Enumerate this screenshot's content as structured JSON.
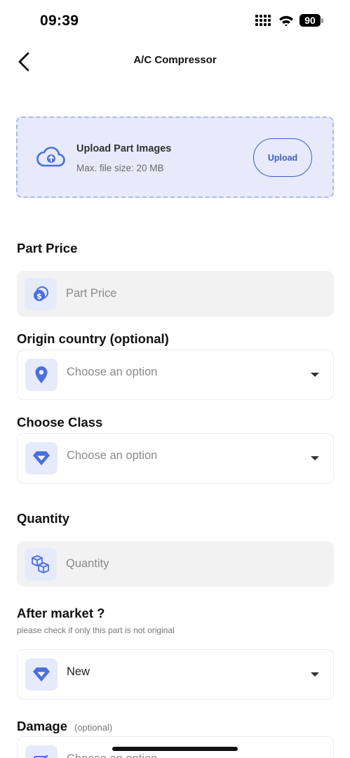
{
  "status_bar": {
    "time": "09:39",
    "battery": "90",
    "icons": [
      "signal-icon",
      "wifi-icon",
      "battery-icon"
    ]
  },
  "nav": {
    "title": "A/C Compressor",
    "back_icon": "chevron-left-icon"
  },
  "upload": {
    "title": "Upload Part Images",
    "subtitle": "Max. file size: 20 MB",
    "button_label": "Upload",
    "icon": "cloud-upload-icon"
  },
  "form": {
    "part_price": {
      "label": "Part Price",
      "placeholder": "Part Price",
      "icon": "dollar-coin-icon"
    },
    "origin_country": {
      "label": "Origin country (optional)",
      "value": "Choose an option",
      "icon": "location-pin-icon"
    },
    "choose_class": {
      "label": "Choose Class",
      "value": "Choose an option",
      "icon": "diamond-icon"
    },
    "quantity": {
      "label": "Quantity",
      "placeholder": "Quantity",
      "icon": "boxes-icon"
    },
    "after_market": {
      "label": "After market ?",
      "hint": "please check if only this part is not original",
      "value": "New",
      "icon": "diamond-icon"
    },
    "damage": {
      "label": "Damage",
      "optional": "(optional)",
      "value": "Choose an option",
      "icon": "edit-icon"
    }
  },
  "colors": {
    "accent": "#3f5fc4",
    "icon_blue": "#4a6fe0",
    "upload_bg": "#e6eafb",
    "upload_border": "#a9b6f3",
    "input_bg": "#f2f2f2"
  }
}
